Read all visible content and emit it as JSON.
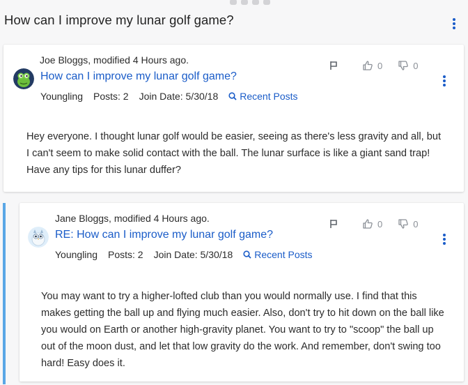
{
  "thread": {
    "title": "How can I improve my lunar golf game?"
  },
  "posts": [
    {
      "author_line": "Joe Bloggs, modified 4 Hours ago.",
      "title": "How can I improve my lunar golf game?",
      "rank": "Youngling",
      "posts": "Posts: 2",
      "join": "Join Date: 5/30/18",
      "recent": "Recent Posts",
      "likes": "0",
      "dislikes": "0",
      "body": "Hey everyone. I thought lunar golf would be easier, seeing as there's less gravity and all, but I can't seem to make solid contact with the ball. The lunar surface is like a giant sand trap! Have any tips for this lunar duffer?"
    },
    {
      "author_line": "Jane Bloggs, modified 4 Hours ago.",
      "title": "RE: How can I improve my lunar golf game?",
      "rank": "Youngling",
      "posts": "Posts: 2",
      "join": "Join Date: 5/30/18",
      "recent": "Recent Posts",
      "likes": "0",
      "dislikes": "0",
      "body": "You may want to try a higher-lofted club than you would normally use. I find that this makes getting the ball up and flying much easier. Also, don't try to hit down on the ball like you would on Earth or another high-gravity planet. You want to try to \"scoop\" the ball up out of the moon dust, and let that low gravity do the work. And remember, don't swing too hard! Easy does it."
    }
  ],
  "colors": {
    "accent": "#1a5cc8",
    "reply_bar": "#5aa7e6",
    "muted": "#8a8f96"
  },
  "icons": [
    "flag-icon",
    "thumbs-up-icon",
    "thumbs-down-icon",
    "search-icon",
    "kebab-menu-icon",
    "frog-avatar",
    "owl-avatar"
  ]
}
